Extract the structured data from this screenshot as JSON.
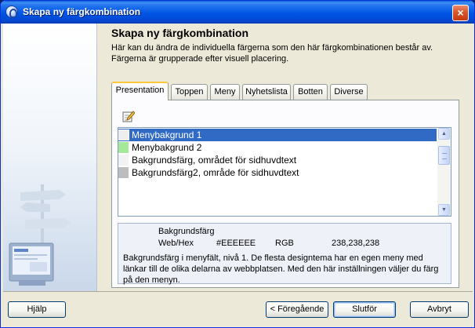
{
  "window": {
    "title": "Skapa ny färgkombination"
  },
  "header": {
    "title": "Skapa ny färgkombination",
    "description": "Här kan du ändra de individuella färgerna som den här färgkombinationen består av. Färgerna är grupperade efter visuell placering."
  },
  "tabs": [
    {
      "label": "Presentation",
      "active": true
    },
    {
      "label": "Toppen",
      "active": false
    },
    {
      "label": "Meny",
      "active": false
    },
    {
      "label": "Nyhetslista",
      "active": false
    },
    {
      "label": "Botten",
      "active": false
    },
    {
      "label": "Diverse",
      "active": false
    }
  ],
  "toolbar": {
    "edit_icon": "edit-icon"
  },
  "color_list": [
    {
      "label": "Menybakgrund 1",
      "color": "#EEEEEE",
      "selected": true
    },
    {
      "label": "Menybakgrund 2",
      "color": "#A6E89A",
      "selected": false
    },
    {
      "label": "Bakgrundsfärg, området för sidhuvdtext",
      "color": "#F2F2F2",
      "selected": false
    },
    {
      "label": "Bakgrundsfärg2, område för sidhuvdtext",
      "color": "#BDBDBD",
      "selected": false
    }
  ],
  "info": {
    "name": "Bakgrundsfärg",
    "webhex_label": "Web/Hex",
    "webhex_value": "#EEEEEE",
    "rgb_label": "RGB",
    "rgb_value": "238,238,238",
    "description": "Bakgrundsfärg  i menyfält, nivå 1. De flesta designtema har en egen meny med länkar till de olika delarna av webbplatsen. Med den här inställningen väljer du färg på den menyn."
  },
  "buttons": {
    "help": "Hjälp",
    "back": "Föregående",
    "back_prefix": "<",
    "finish": "Slutför",
    "cancel": "Avbryt",
    "close": "×"
  }
}
